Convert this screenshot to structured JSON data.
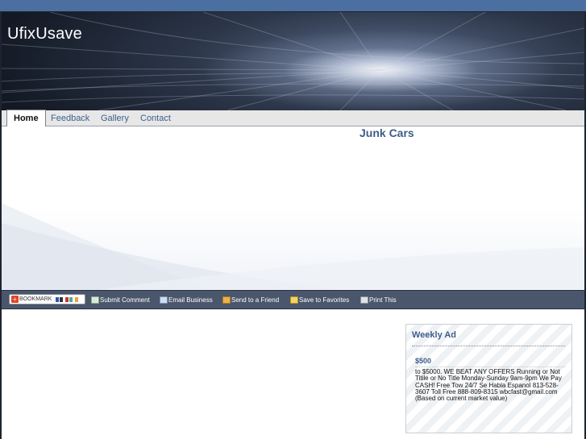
{
  "site": {
    "title": "UfixUsave"
  },
  "nav": {
    "items": [
      {
        "label": "Home",
        "active": true
      },
      {
        "label": "Feedback",
        "active": false
      },
      {
        "label": "Gallery",
        "active": false
      },
      {
        "label": "Contact",
        "active": false
      }
    ]
  },
  "page": {
    "heading": "Junk Cars"
  },
  "toolbar": {
    "bookmark_label": "BOOKMARK",
    "items": [
      {
        "label": "Submit Comment",
        "icon": "comment-icon"
      },
      {
        "label": "Email Business",
        "icon": "email-icon"
      },
      {
        "label": "Send to a Friend",
        "icon": "send-friend-icon"
      },
      {
        "label": "Save to Favorites",
        "icon": "favorites-icon"
      },
      {
        "label": "Print This",
        "icon": "print-icon"
      }
    ]
  },
  "weekly_ad": {
    "title": "Weekly Ad",
    "price": "$500",
    "description": "to $5000.  WE BEAT ANY OFFERS Running or Not Titile or No Title Monday-Sunday 9am-9pm We Pay  CASH! Free Tow 24/7 Se Habla Espanol 813-528-3607  Toll Free 888-809-8315 wbcfast@gmail.com (Based on  current market value)"
  },
  "colors": {
    "page_background": "#4b6fa0",
    "nav_link": "#3d5f8f",
    "heading": "#3e5d89",
    "toolbar": "#4a566b"
  }
}
